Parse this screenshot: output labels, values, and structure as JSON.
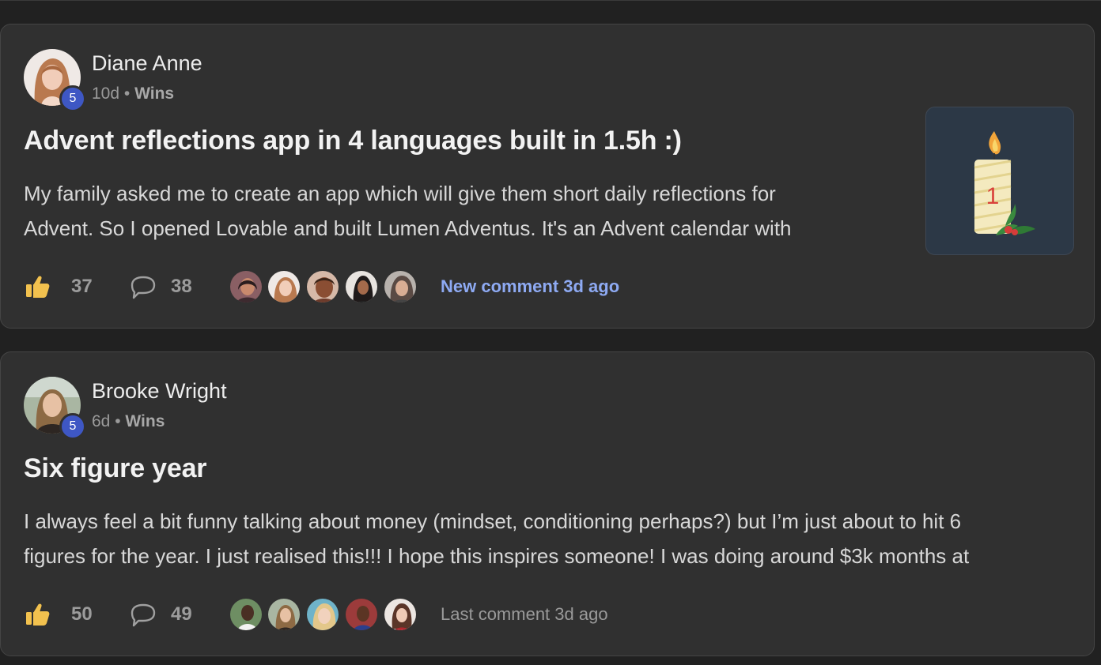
{
  "posts": [
    {
      "author": "Diane Anne",
      "level": "5",
      "age": "10d",
      "separator": "•",
      "category": "Wins",
      "title": "Advent reflections app in 4 languages built in 1.5h :)",
      "body_lines": [
        "My family asked me to create an app which will give them short daily reflections for",
        "Advent. So I opened Lovable and built Lumen Adventus. It's an Advent calendar with"
      ],
      "likes": "37",
      "comments": "38",
      "last_comment": "New comment 3d ago",
      "thumbnail_icon": "candle-icon",
      "thumbnail_number": "1"
    },
    {
      "author": "Brooke Wright",
      "level": "5",
      "age": "6d",
      "separator": "•",
      "category": "Wins",
      "title": "Six figure year",
      "body_lines": [
        "I always feel a bit funny talking about money (mindset, conditioning perhaps?) but I’m just about to hit 6",
        "figures for the year. I just realised this!!! I hope this inspires someone! I was doing around $3k months at"
      ],
      "likes": "50",
      "comments": "49",
      "last_comment": "Last comment 3d ago"
    }
  ],
  "icons": {
    "like": "thumbs-up-icon",
    "comment": "comment-bubble-icon"
  },
  "colors": {
    "background": "#212121",
    "card": "#303030",
    "level_badge": "#3e57c4",
    "new_comment": "#8eaaf3",
    "like_icon": "#f2c14e"
  }
}
